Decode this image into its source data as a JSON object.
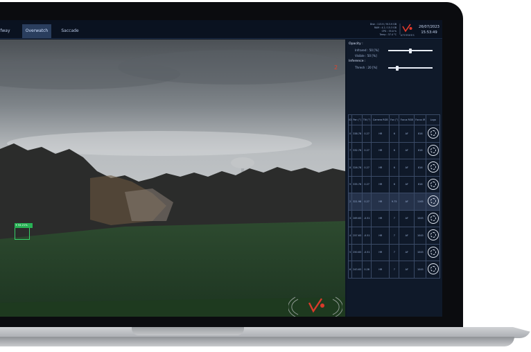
{
  "tabs": [
    {
      "label": "Wolfway",
      "active": false
    },
    {
      "label": "Overwatch",
      "active": true
    },
    {
      "label": "Saccade",
      "active": false
    }
  ],
  "system_stats": [
    "Disk : 113.9 / 913.9 GB",
    "RAM : 4.2 / 15.3 GB",
    "CPU : 35.0 %",
    "Temp : 37.4 °C"
  ],
  "brand": "ATERMES",
  "date": "26/07/2023",
  "time": "15:53:49",
  "view_number": "2",
  "detection_label": "94.21%",
  "opacity": {
    "title": "Opacity :",
    "infrared_label": "Infrared : 50 [%]",
    "infrared_level": 0.5,
    "visible_label": "Visible : 50 [%]"
  },
  "inference": {
    "title": "Inference :",
    "thresh_label": "Thresh : 20 [%]",
    "thresh_level": 0.2
  },
  "table": {
    "headers": [
      "ID",
      "Pan (°)",
      "Tilt (°)",
      "Camera RGB",
      "Fov (°)",
      "Focus RGB",
      "Focus IR",
      "Logo"
    ],
    "rows": [
      [
        "0",
        "338.78",
        "0.27",
        "HR",
        "6",
        "AF",
        "816"
      ],
      [
        "7",
        "332.78",
        "0.27",
        "HR",
        "6",
        "AF",
        "816"
      ],
      [
        "8",
        "326.78",
        "0.27",
        "HR",
        "6",
        "AF",
        "816"
      ],
      [
        "9",
        "335.78",
        "0.27",
        "HR",
        "6",
        "AF",
        "816"
      ],
      [
        "2",
        "321.98",
        "0.27",
        "HR",
        "9.75",
        "AF",
        "1165"
      ],
      [
        "3",
        "269.63",
        "-0.51",
        "HR",
        "7",
        "AF",
        "1045"
      ],
      [
        "4",
        "257.63",
        "-0.51",
        "HR",
        "7",
        "AF",
        "1045"
      ],
      [
        "5",
        "250.63",
        "-0.51",
        "HR",
        "7",
        "AF",
        "1045"
      ],
      [
        "6",
        "243.63",
        "0.28",
        "HR",
        "7",
        "AF",
        "1045"
      ]
    ],
    "highlighted_row": 4
  },
  "progress": 0.73,
  "icons": {
    "logo": "atermes-logo-icon",
    "detect": "paw-icon",
    "legend": "fingerprint-icon"
  }
}
